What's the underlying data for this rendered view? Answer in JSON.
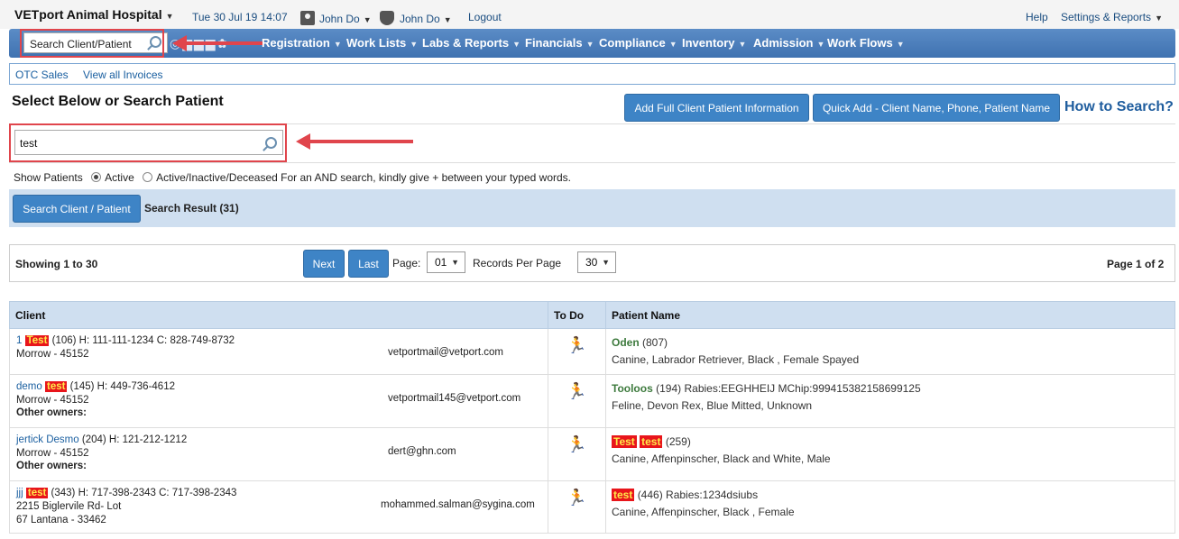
{
  "topbar": {
    "hospital": "VETport Animal Hospital",
    "datetime": "Tue 30 Jul 19 14:07",
    "user1": "John Do",
    "user2": "John Do",
    "logout": "Logout",
    "help": "Help",
    "settings": "Settings & Reports"
  },
  "nav": {
    "search_label": "Search Client/Patient",
    "items": [
      "Registration",
      "Work Lists",
      "Labs & Reports",
      "Financials",
      "Compliance",
      "Inventory",
      "Admission",
      "Work Flows"
    ]
  },
  "subnav": {
    "otc": "OTC Sales",
    "invoices": "View all Invoices"
  },
  "header": {
    "title": "Select Below or Search Patient",
    "add_full": "Add Full Client Patient Information",
    "quick_add": "Quick Add - Client Name, Phone, Patient Name",
    "how_to": "How to Search?"
  },
  "search": {
    "value": "test",
    "show_patients": "Show Patients",
    "opt_active": "Active",
    "opt_all": "Active/Inactive/Deceased For an AND search, kindly give + between your typed words.",
    "button": "Search Client / Patient",
    "result": "Search Result (31)"
  },
  "pager": {
    "showing": "Showing 1 to 30",
    "next": "Next",
    "last": "Last",
    "page_label": "Page:",
    "page_value": "01",
    "rpp_label": "Records Per Page",
    "rpp_value": "30",
    "page_of": "Page 1 of 2"
  },
  "table": {
    "headers": {
      "client": "Client",
      "todo": "To Do",
      "patient": "Patient Name"
    },
    "rows": [
      {
        "c_pre": "1",
        "c_hl": "Test",
        "c_post": "(106)   H: 111-111-1234   C: 828-749-8732",
        "addr1": "Morrow - 45152",
        "addr2": "",
        "other": "",
        "email": "vetportmail@vetport.com",
        "p_hl1": "",
        "p_hl2": "",
        "p_name": "Oden",
        "p_extra": "(807)",
        "p_desc": "Canine, Labrador Retriever, Black , Female Spayed"
      },
      {
        "c_pre": "demo",
        "c_hl": "test",
        "c_post": "(145)   H: 449-736-4612",
        "addr1": "Morrow - 45152",
        "addr2": "",
        "other": "Other owners:",
        "email": "vetportmail145@vetport.com",
        "p_hl1": "",
        "p_hl2": "",
        "p_name": "Tooloos",
        "p_extra": "(194) Rabies:EEGHHEIJ MChip:999415382158699125",
        "p_desc": "Feline, Devon Rex, Blue Mitted, Unknown"
      },
      {
        "c_pre": "jertick Desmo",
        "c_hl": "",
        "c_post": "(204)   H: 121-212-1212",
        "addr1": "Morrow - 45152",
        "addr2": "",
        "other": "Other owners:",
        "email": "dert@ghn.com",
        "p_hl1": "Test",
        "p_hl2": "test",
        "p_name": "",
        "p_extra": "(259)",
        "p_desc": "Canine, Affenpinscher, Black and White, Male"
      },
      {
        "c_pre": "jjj",
        "c_hl": "test",
        "c_post": "(343)   H: 717-398-2343   C: 717-398-2343",
        "addr1": "2215 Biglervile Rd- Lot",
        "addr2": "67 Lantana - 33462",
        "other": "",
        "email": "mohammed.salman@sygina.com",
        "p_hl1": "test",
        "p_hl2": "",
        "p_name": "",
        "p_extra": "(446) Rabies:1234dsiubs",
        "p_desc": "Canine, Affenpinscher, Black , Female"
      }
    ]
  },
  "colors": {
    "nav": "#3f72b1",
    "accent": "#3e84c6",
    "highlight": "#e8151b",
    "annotation": "#e0454c"
  },
  "icons": [
    "search-icon",
    "user-icon",
    "shield-icon",
    "runner-icon",
    "chevron-down-icon"
  ]
}
